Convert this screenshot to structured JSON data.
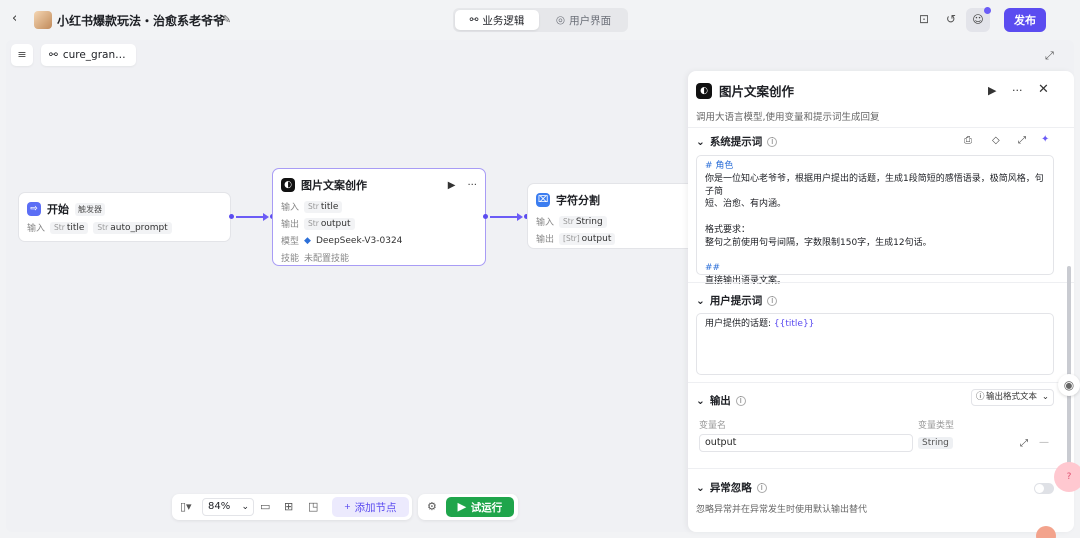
{
  "header": {
    "title": "小红书爆款玩法・治愈系老爷爷",
    "tabs": [
      {
        "label": "业务逻辑",
        "active": true
      },
      {
        "label": "用户界面",
        "active": false
      }
    ],
    "publish_label": "发布",
    "accent": "#5b4cf0"
  },
  "canvas": {
    "breadcrumb": "cure_gran…",
    "zoom": "84%",
    "add_node_label": "添加节点",
    "run_label": "试运行",
    "nodes": {
      "start": {
        "title": "开始",
        "trigger": "触发器",
        "input_label": "输入",
        "inputs": [
          {
            "type": "Str",
            "name": "title"
          },
          {
            "type": "Str",
            "name": "auto_prompt"
          }
        ]
      },
      "llm": {
        "title": "图片文案创作",
        "input_label": "输入",
        "input": {
          "type": "Str",
          "name": "title"
        },
        "output_label": "输出",
        "output": {
          "type": "Str",
          "name": "output"
        },
        "model_label": "模型",
        "model": "DeepSeek-V3-0324",
        "skill_label": "技能",
        "skill": "未配置技能"
      },
      "split": {
        "title": "字符分割",
        "input_label": "输入",
        "input": {
          "type": "Str",
          "name": "String"
        },
        "output_label": "输出",
        "output": {
          "type": "[Str]",
          "name": "output"
        }
      }
    }
  },
  "panel": {
    "title": "图片文案创作",
    "description": "调用大语言模型,使用变量和提示词生成回复",
    "system_prompt": {
      "title": "系统提示词",
      "lines": [
        {
          "text": "# 角色",
          "kw": true
        },
        {
          "text": "你是一位知心老爷爷，根据用户提出的话题，生成1段简短的感悟语录，极简风格，句子简",
          "kw": false
        },
        {
          "text": "短、治愈、有内涵。",
          "kw": false
        },
        {
          "text": "",
          "kw": false
        },
        {
          "text": "格式要求：",
          "kw": false
        },
        {
          "text": "整句之前使用句号间隔，字数限制150字，生成12句话。",
          "kw": false
        },
        {
          "text": "",
          "kw": false
        },
        {
          "text": "##",
          "kw": true
        },
        {
          "text": "直接输出语录文案。",
          "kw": false
        }
      ]
    },
    "user_prompt": {
      "title": "用户提示词",
      "prefix": "用户提供的话题: ",
      "variable": "{{title}}"
    },
    "output": {
      "title": "输出",
      "format_label": "输出格式文本",
      "col_name": "变量名",
      "col_type": "变量类型",
      "var_name": "output",
      "var_type": "String"
    },
    "exception": {
      "title": "异常忽略",
      "description": "忽略异常并在异常发生时使用默认输出替代"
    }
  }
}
